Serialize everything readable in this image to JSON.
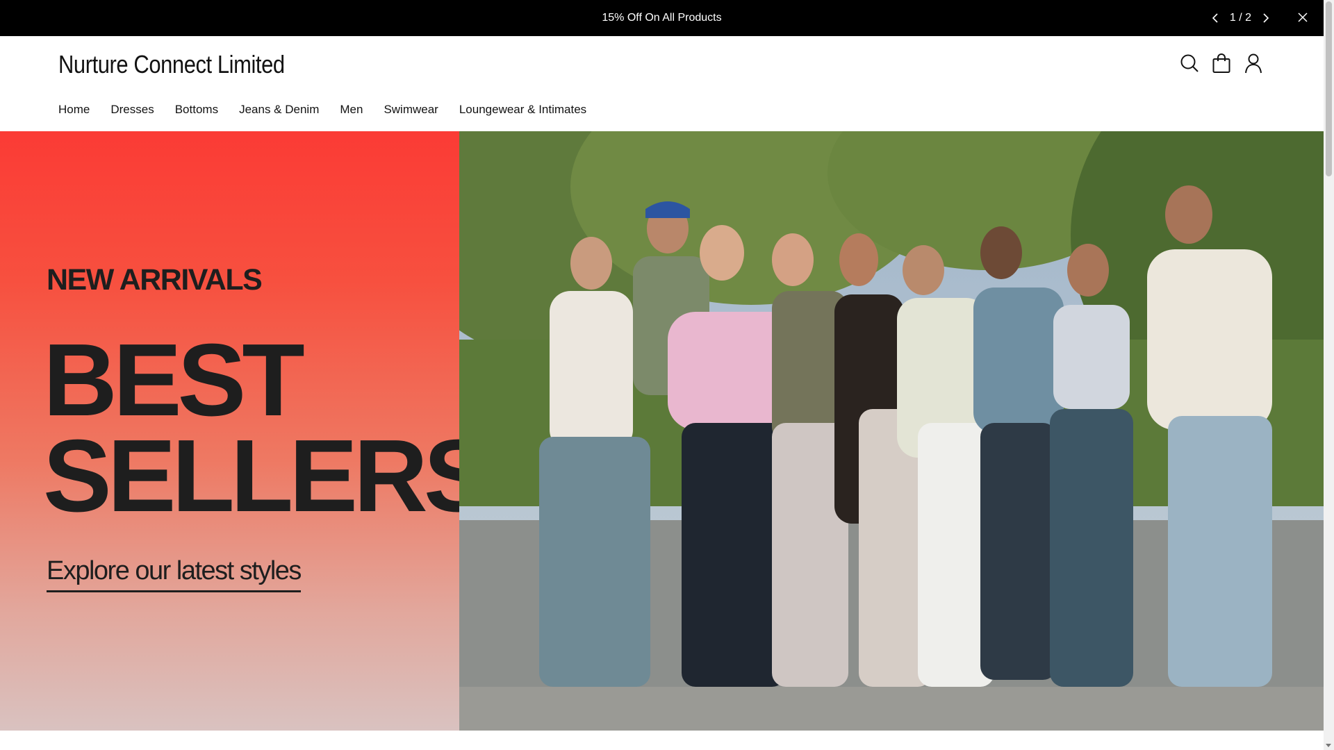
{
  "announcement": {
    "text": "15% Off On All Products",
    "pager": "1 / 2"
  },
  "header": {
    "logo": "Nurture Connect Limited",
    "icons": [
      "search-icon",
      "cart-icon",
      "account-icon"
    ]
  },
  "nav": {
    "items": [
      "Home",
      "Dresses",
      "Bottoms",
      "Jeans & Denim",
      "Men",
      "Swimwear",
      "Loungewear & Intimates"
    ]
  },
  "hero": {
    "eyebrow": "NEW ARRIVALS",
    "headline_line1": "BEST",
    "headline_line2": "SELLERS",
    "cta": "Explore our latest styles",
    "colors": {
      "gradient_top": "#fb3b35",
      "gradient_bottom": "#d9c2c0",
      "text": "#1e1e1e"
    }
  }
}
